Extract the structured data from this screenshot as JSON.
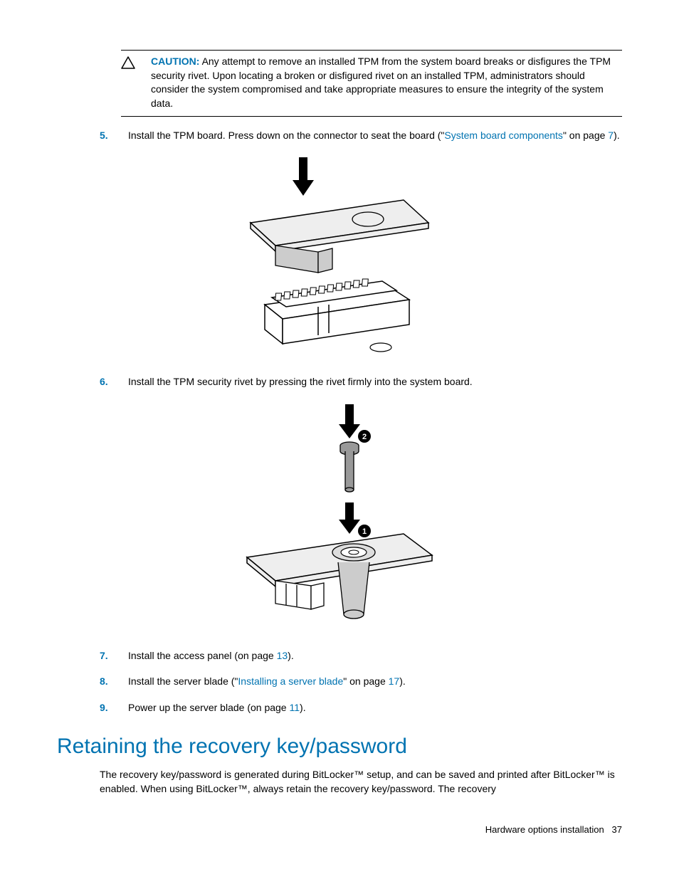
{
  "caution": {
    "label": "CAUTION:",
    "text": "Any attempt to remove an installed TPM from the system board breaks or disfigures the TPM security rivet. Upon locating a broken or disfigured rivet on an installed TPM, administrators should consider the system compromised and take appropriate measures to ensure the integrity of the system data."
  },
  "steps": {
    "s5": {
      "num": "5.",
      "pre": "Install the TPM board. Press down on the connector to seat the board (\"",
      "link": "System board components",
      "mid": "\" on page ",
      "page": "7",
      "post": ")."
    },
    "s6": {
      "num": "6.",
      "text": "Install the TPM security rivet by pressing the rivet firmly into the system board."
    },
    "s7": {
      "num": "7.",
      "pre": "Install the access panel (on page ",
      "page": "13",
      "post": ")."
    },
    "s8": {
      "num": "8.",
      "pre": "Install the server blade (\"",
      "link": "Installing a server blade",
      "mid": "\" on page ",
      "page": "17",
      "post": ")."
    },
    "s9": {
      "num": "9.",
      "pre": "Power up the server blade (on page ",
      "page": "11",
      "post": ")."
    }
  },
  "heading": "Retaining the recovery key/password",
  "paragraph": "The recovery key/password is generated during BitLocker™ setup, and can be saved and printed after BitLocker™ is enabled. When using BitLocker™, always retain the recovery key/password. The recovery",
  "footer": {
    "section": "Hardware options installation",
    "page": "37"
  }
}
